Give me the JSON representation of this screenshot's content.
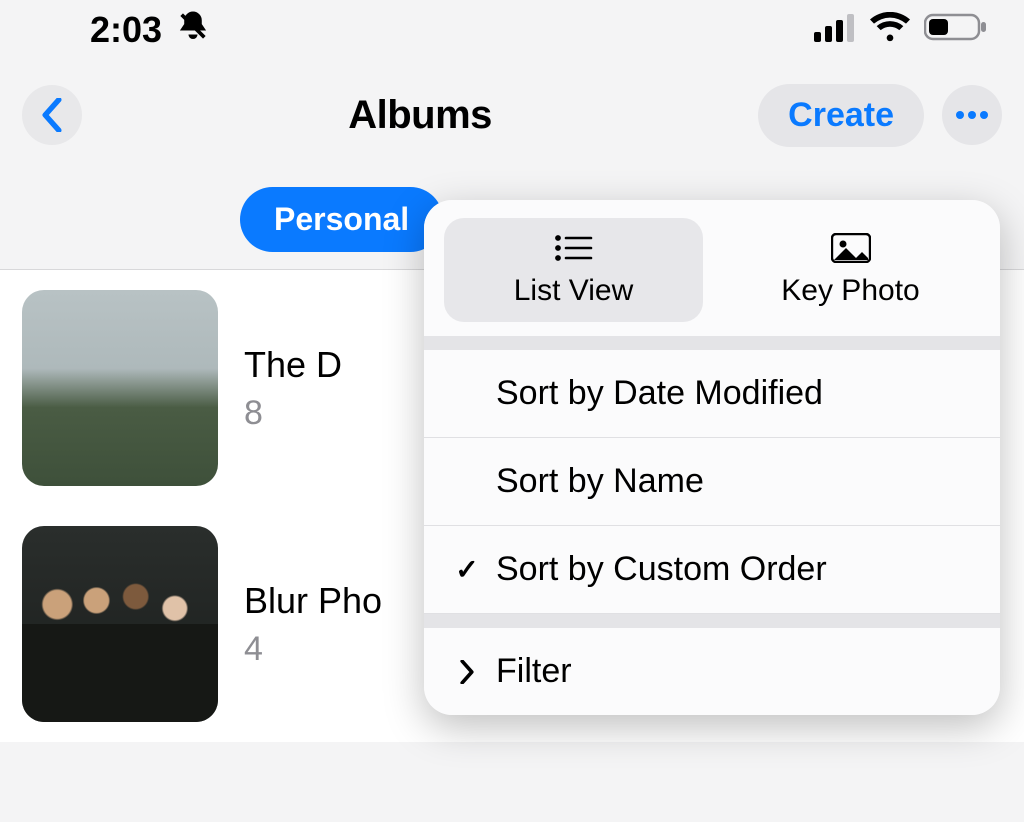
{
  "status": {
    "time": "2:03",
    "silent_icon": "bell-slash"
  },
  "nav": {
    "title": "Albums",
    "create_label": "Create"
  },
  "chips": {
    "personal": "Personal"
  },
  "albums": [
    {
      "title": "The D",
      "count": "8"
    },
    {
      "title": "Blur Pho",
      "count": "4"
    }
  ],
  "popover": {
    "tabs": {
      "list_view": "List View",
      "key_photo": "Key Photo"
    },
    "sort": {
      "date_modified": "Sort by Date Modified",
      "name": "Sort by Name",
      "custom_order": "Sort by Custom Order"
    },
    "filter": "Filter"
  }
}
